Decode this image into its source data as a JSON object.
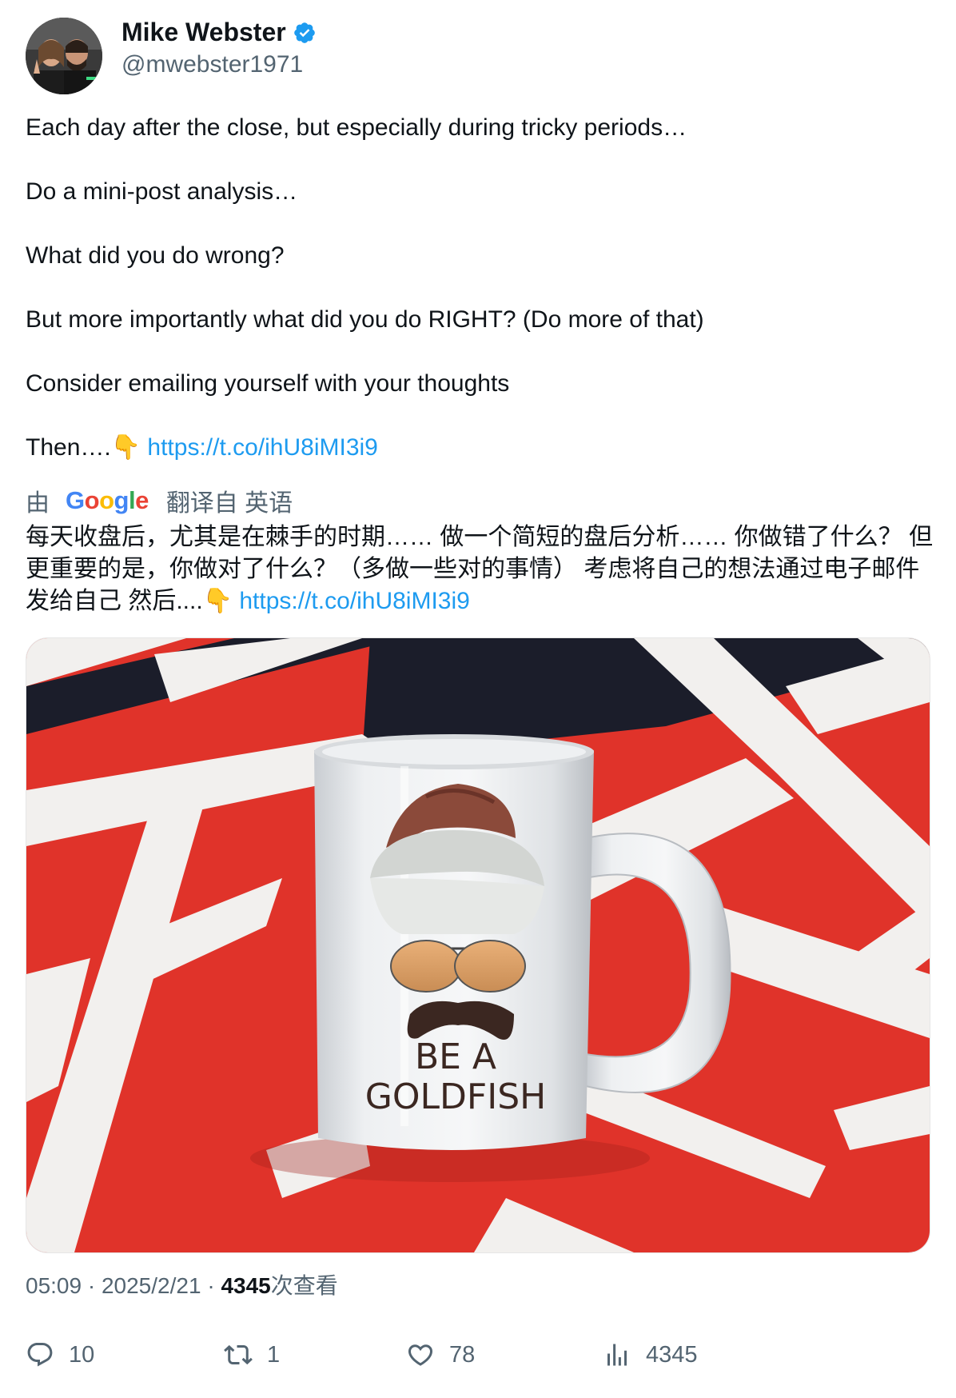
{
  "author": {
    "name": "Mike Webster",
    "handle": "@mwebster1971",
    "verified": true
  },
  "tweet": {
    "lines": [
      "Each day after the close, but especially during tricky periods…",
      "Do a mini-post analysis…",
      "What did you do wrong?",
      "But  more importantly what did you do RIGHT? (Do more of that)",
      "Consider emailing yourself with your thoughts"
    ],
    "last_prefix": "Then….👇 ",
    "link": "https://t.co/ihU8iMI3i9"
  },
  "translation": {
    "by_label": "由",
    "google_logo": "Google",
    "from_label": "翻译自 英语",
    "text": "每天收盘后，尤其是在棘手的时期…… 做一个简短的盘后分析…… 你做错了什么？ 但更重要的是，你做对了什么？（多做一些对的事情） 考虑将自己的想法通过电子邮件发给自己 然后....👇 ",
    "link": "https://t.co/ihU8iMI3i9"
  },
  "media": {
    "mug_text_line1": "BE A",
    "mug_text_line2": "GOLDFISH"
  },
  "meta": {
    "time": "05:09",
    "date": "2025/2/21",
    "views": "4345",
    "views_label": "次查看",
    "separator": "·"
  },
  "actions": {
    "replies": "10",
    "retweets": "1",
    "likes": "78",
    "views": "4345"
  },
  "colors": {
    "link": "#1d9bf0",
    "secondary_text": "#536471",
    "verified": "#1d9bf0"
  }
}
